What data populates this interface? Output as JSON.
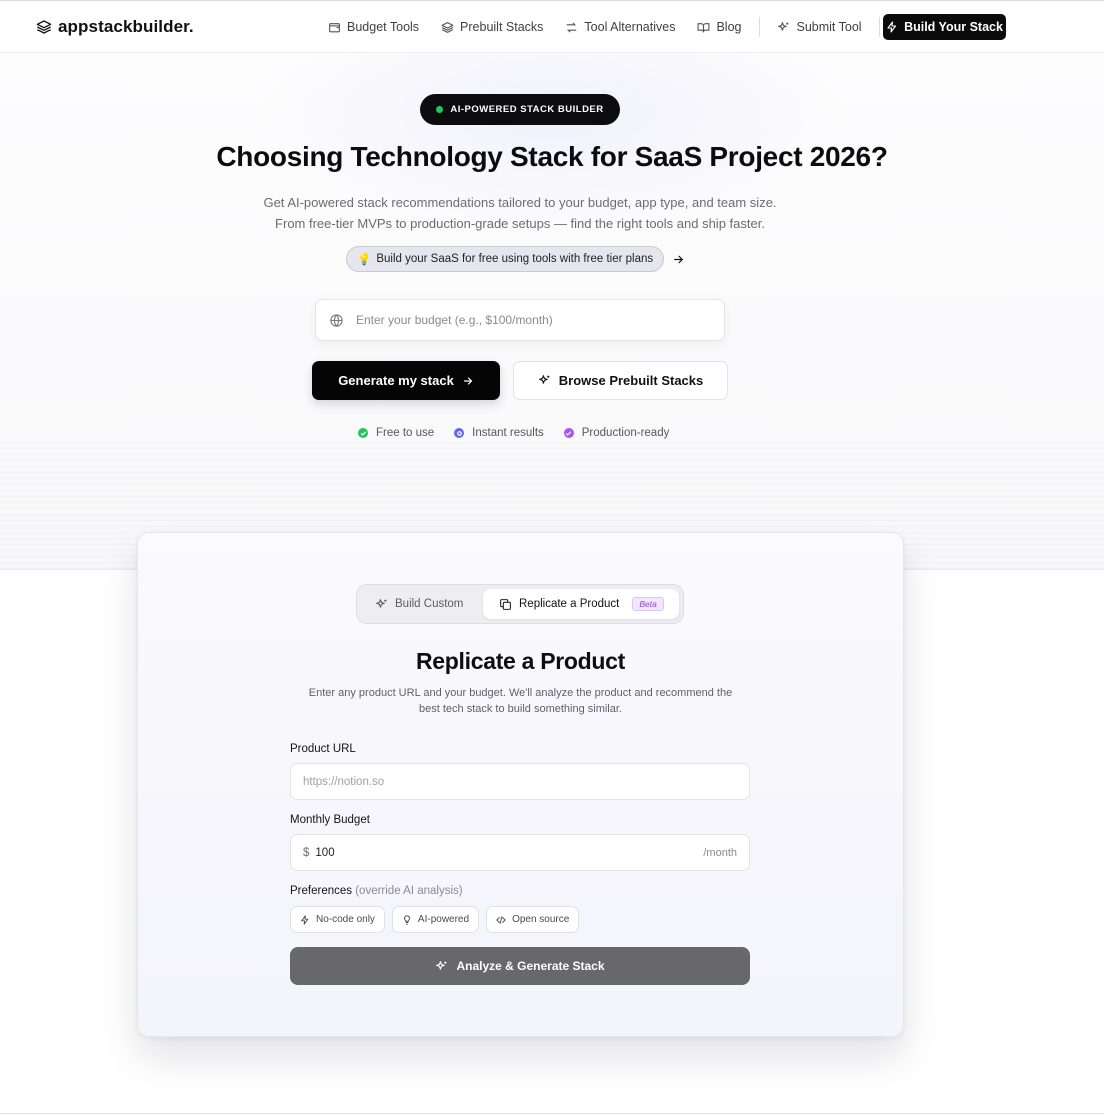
{
  "brand": {
    "name": "appstackbuilder."
  },
  "nav": {
    "links": [
      {
        "label": "Budget Tools",
        "icon": "wallet-icon"
      },
      {
        "label": "Prebuilt Stacks",
        "icon": "layers-icon"
      },
      {
        "label": "Tool Alternatives",
        "icon": "swap-arrows-icon"
      },
      {
        "label": "Blog",
        "icon": "book-open-icon"
      },
      {
        "label": "Submit Tool",
        "icon": "sparkles-icon"
      }
    ],
    "cta": "Build Your Stack"
  },
  "hero": {
    "badge": "AI-POWERED STACK BUILDER",
    "title": "Choosing Technology Stack for SaaS Project 2026?",
    "subtitle_line1": "Get AI-powered stack recommendations tailored to your budget, app type, and team size.",
    "subtitle_line2": "From free-tier MVPs to production-grade setups — find the right tools and ship faster.",
    "tip": "Build your SaaS for free using tools with free tier plans",
    "tip_emoji": "💡",
    "budget_placeholder": "Enter your budget (e.g., $100/month)",
    "generate_label": "Generate my stack",
    "browse_label": "Browse Prebuilt Stacks",
    "features": [
      {
        "label": "Free to use",
        "color": "#22c55e"
      },
      {
        "label": "Instant results",
        "color": "#6366f1"
      },
      {
        "label": "Production-ready",
        "color": "#a855f7"
      }
    ]
  },
  "card": {
    "tabs": {
      "custom": "Build Custom",
      "replicate": "Replicate a Product",
      "beta": "Beta"
    },
    "title": "Replicate a Product",
    "desc_line1": "Enter any product URL and your budget. We'll analyze the product and recommend the",
    "desc_line2": "best tech stack to build something similar.",
    "url_label": "Product URL",
    "url_placeholder": "https://notion.so",
    "budget_label": "Monthly Budget",
    "currency": "$",
    "budget_value": "100",
    "per_month": "/month",
    "pref_label": "Preferences",
    "pref_hint": "(override AI analysis)",
    "chips": [
      {
        "label": "No-code only",
        "icon": "bolt-icon"
      },
      {
        "label": "AI-powered",
        "icon": "lightbulb-icon"
      },
      {
        "label": "Open source",
        "icon": "code-icon"
      }
    ],
    "analyze_label": "Analyze & Generate Stack"
  }
}
